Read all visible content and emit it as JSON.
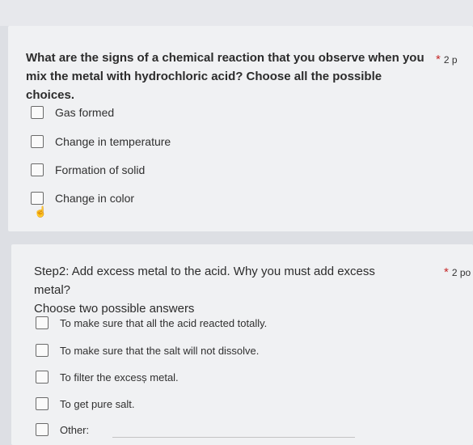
{
  "question1": {
    "text": "What are the signs of a chemical reaction that you observe when you mix the metal with hydrochloric acid? Choose all the possible choices.",
    "required_mark": "*",
    "points": "2 p",
    "options": [
      {
        "label": "Gas formed",
        "checked": false
      },
      {
        "label": "Change in temperature",
        "checked": false
      },
      {
        "label": "Formation of solid",
        "checked": false
      },
      {
        "label": "Change in color",
        "checked": false
      }
    ]
  },
  "question2": {
    "line1": "Step2: Add excess metal to the acid. Why you must add excess metal?",
    "line2": "Choose two possible answers",
    "required_mark": "*",
    "points": "2 po",
    "options": [
      {
        "label": "To make sure that all the acid reacted totally.",
        "checked": false
      },
      {
        "label": "To make sure that the salt will not dissolve.",
        "checked": false
      },
      {
        "label": "To filter the excesș metal.",
        "checked": false
      },
      {
        "label": "To get pure salt.",
        "checked": false
      },
      {
        "label": "Other:",
        "checked": false
      }
    ]
  },
  "colors": {
    "page_bg": "#dddfe4",
    "card_bg": "#f0f1f3",
    "required_star": "#c62828",
    "checkbox_border": "#6a6a6a"
  },
  "icons": {
    "cursor": "hand-pointer-icon"
  }
}
